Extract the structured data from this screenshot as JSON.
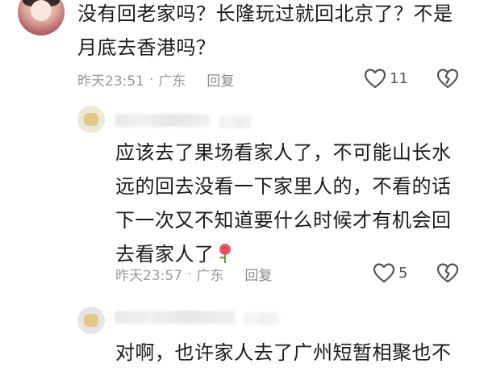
{
  "comments": [
    {
      "text_line1": "没有回老家吗？长隆玩过就回北京了？不是",
      "text_line2": "月底去香港吗？",
      "time": "昨天23:51",
      "separator": "·",
      "location": "广东",
      "reply_label": "回复",
      "likes": "11"
    },
    {
      "text_line1": "应该去了果场看家人了，不可能山长水",
      "text_line2": "远的回去没看一下家里人的，不看的话",
      "text_line3": "下一次又不知道要什么时候才有机会回",
      "text_line4": "去看家人了",
      "time": "昨天23:57",
      "separator": "·",
      "location": "广东",
      "reply_label": "回复",
      "likes": "5",
      "emoji": "rose-emoji"
    },
    {
      "text_line1": "对啊，也许家人去了广州短暂相聚也不"
    }
  ],
  "icons": {
    "like": "heart-outline-icon",
    "dislike": "broken-heart-icon"
  },
  "colors": {
    "text": "#1a1a1a",
    "meta": "#9a9a9a",
    "icon": "#555555"
  }
}
